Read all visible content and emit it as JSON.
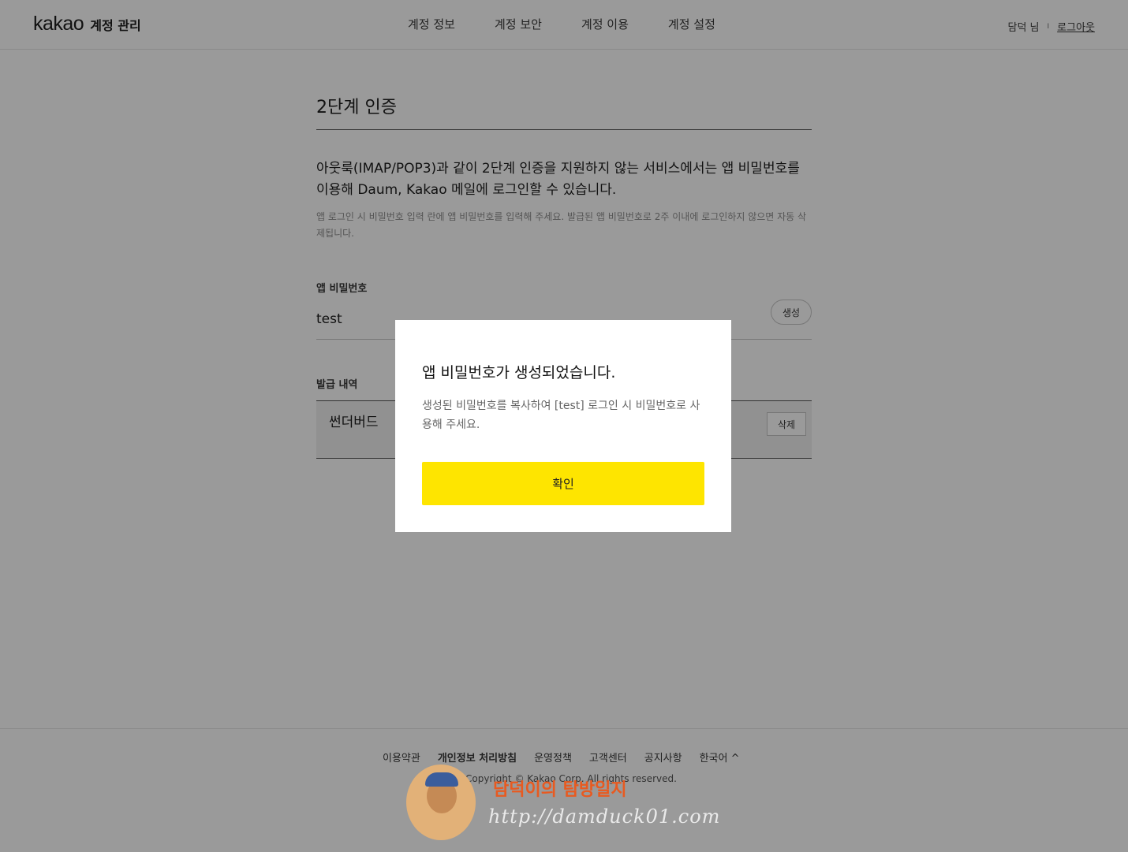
{
  "header": {
    "brand_logo": "kakao",
    "brand_sub": "계정 관리",
    "nav": [
      "계정 정보",
      "계정 보안",
      "계정 이용",
      "계정 설정"
    ],
    "user_name": "담덕 님",
    "separator": "I",
    "logout": "로그아웃"
  },
  "main": {
    "title": "2단계 인증",
    "description": "아웃룩(IMAP/POP3)과 같이 2단계 인증을 지원하지 않는 서비스에서는 앱 비밀번호를 이용해 Daum, Kakao 메일에 로그인할 수 있습니다.",
    "note": "앱 로그인 시 비밀번호 입력 란에 앱 비밀번호를 입력해 주세요. 발급된 앱 비밀번호로 2주 이내에 로그인하지 않으면 자동 삭제됩니다.",
    "app_password_label": "앱 비밀번호",
    "app_password_value": "test",
    "generate_button": "생성",
    "history_label": "발급 내역",
    "history_items": [
      {
        "name": "썬더버드",
        "delete_label": "삭제"
      }
    ]
  },
  "footer": {
    "links": [
      "이용약관",
      "개인정보 처리방침",
      "운영정책",
      "고객센터",
      "공지사항",
      "한국어 ^"
    ],
    "copyright": "Copyright © Kakao Corp. All rights reserved."
  },
  "modal": {
    "title": "앱 비밀번호가 생성되었습니다.",
    "message": "생성된 비밀번호를 복사하여 [test] 로그인 시 비밀번호로 사용해 주세요.",
    "confirm_button": "확인"
  },
  "watermark": {
    "title": "담덕이의 탐방일지",
    "url": "http://damduck01.com"
  },
  "colors": {
    "overlay_background": "#9a9a9a",
    "confirm_button": "#fee500",
    "watermark_title": "#e85a20"
  }
}
